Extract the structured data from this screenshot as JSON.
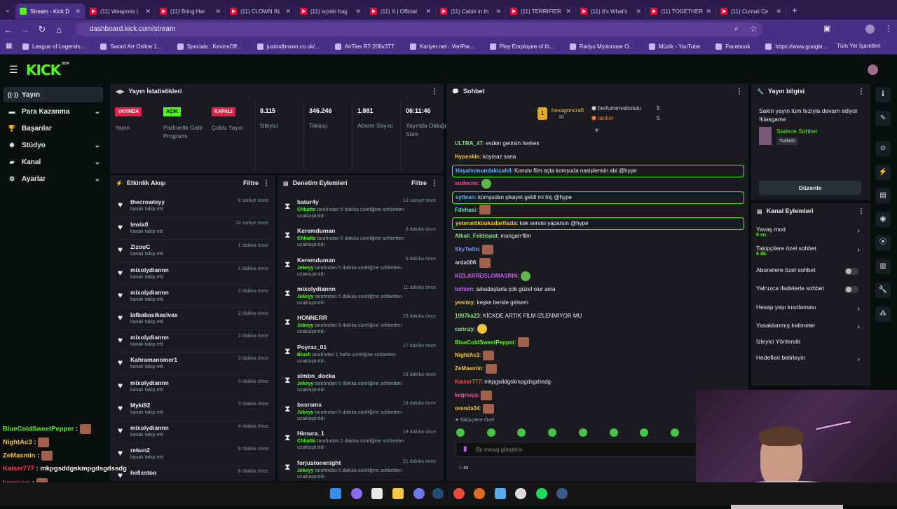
{
  "browser": {
    "tabs": [
      {
        "title": "Stream - Kick D",
        "active": true
      },
      {
        "title": "(11) Weapons |"
      },
      {
        "title": "(11) Bring Her"
      },
      {
        "title": "(11) CLOWN IN"
      },
      {
        "title": "(11) srpski frag"
      },
      {
        "title": "(11) X | Official"
      },
      {
        "title": "(11) Cabin in th"
      },
      {
        "title": "(11) TERRIFIER"
      },
      {
        "title": "(11) It's What's"
      },
      {
        "title": "(11) TOGETHER"
      },
      {
        "title": "(11) Cumali Ce"
      }
    ],
    "url": "dashboard.kick.com/stream",
    "bookmarks": [
      "League of Legends...",
      "Sword Art Online 1...",
      "Specials : KevinsOff...",
      "justindbrown.co.uk/...",
      "AirTies RT-206v3TT",
      "Kariyer.net - VeriPar...",
      "Play Employee of th...",
      "Radyo Mydonose O...",
      "Müzik - YouTube",
      "Facebook",
      "https://www.google..."
    ],
    "all_bookmarks": "Tüm Yer İşaretleri"
  },
  "brand": {
    "logo": "KICK",
    "beta": "BETA",
    "accent": "#53fc18"
  },
  "sidebar": {
    "items": [
      {
        "label": "Yayın",
        "icon": "broadcast-icon",
        "active": true
      },
      {
        "label": "Para Kazanma",
        "icon": "money-icon",
        "chevron": true
      },
      {
        "label": "Başarılar",
        "icon": "trophy-icon"
      },
      {
        "label": "Stüdyo",
        "icon": "studio-icon",
        "chevron": true
      },
      {
        "label": "Kanal",
        "icon": "channel-icon",
        "chevron": true
      },
      {
        "label": "Ayarlar",
        "icon": "gear-icon",
        "chevron": true
      }
    ]
  },
  "stats": {
    "title": "Yayın İstatistikleri",
    "items": [
      {
        "badge": "YAYINDA",
        "badge_color": "#e91e4d",
        "label": "Yayın"
      },
      {
        "badge": "AÇIK",
        "badge_color": "#53fc18",
        "label": "Partnerlik Gelir Programı"
      },
      {
        "badge": "KAPALI",
        "badge_color": "#e91e4d",
        "label": "Çoklu Yayın"
      },
      {
        "value": "8.115",
        "label": "İzleyici"
      },
      {
        "value": "346.246",
        "label": "Takipçi"
      },
      {
        "value": "1.881",
        "label": "Abone Sayısı"
      },
      {
        "value": "06:11:46",
        "label": "Yayında Olduğu Süre"
      }
    ]
  },
  "activity": {
    "title": "Etkinlik Akışı",
    "filter": "Filtre",
    "rows": [
      {
        "name": "thecrowleyy",
        "sub": "kanalı takip etti",
        "time": "8 saniye önce"
      },
      {
        "name": "lewix0",
        "sub": "kanalı takip etti",
        "time": "24 saniye önce"
      },
      {
        "name": "ZizouC",
        "sub": "kanalı takip etti",
        "time": "1 dakika önce"
      },
      {
        "name": "mixolydiannn",
        "sub": "kanalı takip etti",
        "time": "1 dakika önce"
      },
      {
        "name": "mixolydiannn",
        "sub": "kanalı takip etti",
        "time": "2 dakika önce"
      },
      {
        "name": "lafbabasikasivax",
        "sub": "kanalı takip etti",
        "time": "2 dakika önce"
      },
      {
        "name": "mixolydiannn",
        "sub": "kanalı takip etti",
        "time": "2 dakika önce"
      },
      {
        "name": "Kahramanomer1",
        "sub": "kanalı takip etti",
        "time": "3 dakika önce"
      },
      {
        "name": "mixolydiannn",
        "sub": "kanalı takip etti",
        "time": "3 dakika önce"
      },
      {
        "name": "Myki92",
        "sub": "kanalı takip etti",
        "time": "3 dakika önce"
      },
      {
        "name": "mixolydiannn",
        "sub": "kanalı takip etti",
        "time": "4 dakika önce"
      },
      {
        "name": "rekun2",
        "sub": "kanalı takip etti",
        "time": "8 dakika önce"
      },
      {
        "name": "hellsstoo",
        "sub": "",
        "time": "8 dakika önce"
      }
    ]
  },
  "moderation": {
    "title": "Denetim Eylemleri",
    "filter": "Filtre",
    "rows": [
      {
        "name": "batur4y",
        "mod": "Chhatto",
        "text": "tarafından 5 dakika süreliğine sohbetten uzaklaştırıldı",
        "time": "13 saniye önce"
      },
      {
        "name": "Keremduman",
        "mod": "Chhatto",
        "text": "tarafından 5 dakika süreliğine sohbetten uzaklaştırıldı",
        "time": "6 dakika önce"
      },
      {
        "name": "Keremduman",
        "mod": "Jekeyy",
        "text": "tarafından 5 dakika süreliğine sohbetten uzaklaştırıldı",
        "time": "6 dakika önce"
      },
      {
        "name": "mixolydiannn",
        "mod": "Jekeyy",
        "text": "tarafından 5 dakika süreliğine sohbetten uzaklaştırıldı",
        "time": "11 dakika önce"
      },
      {
        "name": "HONNERR",
        "mod": "Jekeyy",
        "text": "tarafından 5 dakika süreliğine sohbetten uzaklaştırıldı",
        "time": "15 dakika önce"
      },
      {
        "name": "Poyraz_01",
        "mod": "Blush",
        "text": "tarafından 1 hafta süreliğine sohbetten uzaklaştırıldı",
        "time": "17 dakika önce"
      },
      {
        "name": "slmbn_docka",
        "mod": "Jekeyy",
        "text": "tarafından 5 dakika süreliğine sohbetten uzaklaştırıldı",
        "time": "18 dakika önce"
      },
      {
        "name": "bxsramx",
        "mod": "Jekeyy",
        "text": "tarafından 5 dakika süreliğine sohbetten uzaklaştırıldı",
        "time": "18 dakika önce"
      },
      {
        "name": "Himura_1",
        "mod": "Chhatto",
        "text": "tarafından 1 dakika süreliğine sohbetten uzaklaştırıldı",
        "time": "19 dakika önce"
      },
      {
        "name": "forjustonenight",
        "mod": "Jekeyy",
        "text": "tarafından 5 dakika süreliğine sohbetten uzaklaştırıldı",
        "time": "21 dakika önce"
      }
    ]
  },
  "chat": {
    "title": "Sohbet",
    "top_gifters": [
      {
        "name": "hexagoncraft",
        "count": "10"
      },
      {
        "name": "berfumervebolulu",
        "count": "5"
      },
      {
        "name": "tarikor",
        "count": "5"
      }
    ],
    "messages": [
      {
        "user": "ULTRA_47",
        "color": "#8ee08e",
        "text": "evden getirsin herkes"
      },
      {
        "user": "Hypeskin",
        "color": "#f5c542",
        "text": "koymaz sana"
      },
      {
        "user": "Hayalsonundakicahil",
        "color": "#5ab8ff",
        "text": "Konulu film açta komşuda nasiplensin abi @hype",
        "highlight": true
      },
      {
        "user": "sudecmr",
        "color": "#ff4d8d",
        "text": "",
        "emote": "green"
      },
      {
        "user": "syltean",
        "color": "#5ab8ff",
        "text": "komşudan şikayet geldi mi hiç @hype",
        "highlight": true
      },
      {
        "user": "Fdehasi",
        "color": "#5fe0c0",
        "text": "",
        "emote": "face"
      },
      {
        "user": "yeterartikbukadarifazla",
        "color": "#f5c542",
        "text": "kek servisi yaparsın @hype",
        "highlight": true
      },
      {
        "user": "Alkali_Feldispat",
        "color": "#8ee08e",
        "text": "mangal+film"
      },
      {
        "user": "SkyTw0o",
        "color": "#7b8cff",
        "text": "",
        "emote": "face"
      },
      {
        "user": "arda006",
        "color": "#cfcfcf",
        "text": "",
        "emote": "face"
      },
      {
        "user": "KIZLARREGLOMASINN",
        "color": "#c95aff",
        "text": "",
        "emote": "green"
      },
      {
        "user": "luthien",
        "color": "#c95aff",
        "text": "arkadaşlarla çok güzel olur ama"
      },
      {
        "user": "yesimy",
        "color": "#f5c542",
        "text": "keşke bende gelsem"
      },
      {
        "user": "1907ka23",
        "color": "#8ee08e",
        "text": "KİCKDE ARTIK FİLM İZLENMİYOR MU"
      },
      {
        "user": "cannzy",
        "color": "#8ee08e",
        "text": "",
        "emote": "yellow"
      },
      {
        "user": "BlueColdSweetPepper",
        "color": "#53fc18",
        "text": "",
        "emote": "face"
      },
      {
        "user": "NightAc3",
        "color": "#f5c542",
        "text": "",
        "emote": "face"
      },
      {
        "user": "ZeMasmin",
        "color": "#f5c542",
        "text": "",
        "emote": "face"
      },
      {
        "user": "Kaiser777",
        "color": "#ff4d4d",
        "text": "mkpgsddgskmpgdsgdssdg"
      },
      {
        "user": "kegriuya",
        "color": "#ff4d8d",
        "text": "",
        "emote": "face"
      },
      {
        "user": "orenda34",
        "color": "#f5c542",
        "text": "",
        "emote": "face"
      }
    ],
    "followers_only": "Takipçilere Özel",
    "input_placeholder": "Bir mesaj gönderin"
  },
  "stream_info": {
    "title": "Yayın bilgisi",
    "stream_title": "Sakin yayın tüm hızıyla devam ediyor !klasgame",
    "category": "Sadece Sohbet",
    "tag": "Turkish",
    "edit_button": "Düzenle"
  },
  "channel_actions": {
    "title": "Kanal Eylemleri",
    "rows": [
      {
        "label": "Yavaş mod",
        "sub": "5 sn.",
        "type": "chevron"
      },
      {
        "label": "Takipçilere özel sohbet",
        "sub": "6 dk.",
        "type": "chevron"
      },
      {
        "label": "Abonelere özel sohbet",
        "type": "toggle"
      },
      {
        "label": "Yalnızca ifadelerle sohbet",
        "type": "toggle"
      },
      {
        "label": "Hesap yaşı kısıtlaması",
        "type": "chevron"
      },
      {
        "label": "Yasaklanmış kelimeler",
        "type": "chevron"
      },
      {
        "label": "İzleyici Yönlendir",
        "type": "none"
      },
      {
        "label": "Hedefleri belirleyin",
        "type": "chevron"
      }
    ]
  },
  "overlay_chat": [
    {
      "user": "BlueColdSweetPepper",
      "color": "#53fc18",
      "text": ""
    },
    {
      "user": "NightAc3",
      "color": "#f5c542",
      "text": ""
    },
    {
      "user": "ZeMasmin",
      "color": "#f5c542",
      "text": ""
    },
    {
      "user": "Kaiser777",
      "color": "#ff4d4d",
      "text": "mkpgsddgskmpgdsgdssdg"
    },
    {
      "user": "kegriuya",
      "color": "#ff4d8d",
      "text": ""
    },
    {
      "user": "orenda34",
      "color": "#f5c542",
      "text": ""
    }
  ]
}
